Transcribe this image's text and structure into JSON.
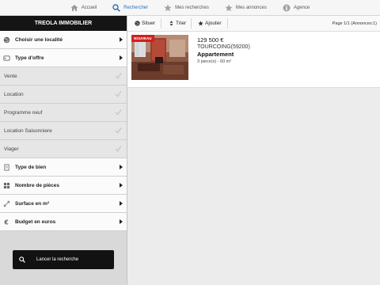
{
  "nav": {
    "items": [
      {
        "label": "Accueil",
        "icon": "home-icon"
      },
      {
        "label": "Rechercher",
        "icon": "search-icon",
        "active": true
      },
      {
        "label": "Mes recherches",
        "icon": "star-icon"
      },
      {
        "label": "Mes annonces",
        "icon": "star-icon"
      },
      {
        "label": "Agence",
        "icon": "info-icon"
      }
    ]
  },
  "sidebar": {
    "brand": "TREOLA IMMOBILIER",
    "locality_label": "Choisir une localité",
    "offer_label": "Type d'offre",
    "offer_options": [
      "Vente",
      "Location",
      "Programme neuf",
      "Location Saisonniere",
      "Viager"
    ],
    "property_type_label": "Type de bien",
    "rooms_label": "Nombre de pièces",
    "surface_label": "Surface en m²",
    "budget_label": "Budget en euros",
    "search_button": "Lancer la recherche"
  },
  "toolbar": {
    "situer": "Situer",
    "trier": "Trier",
    "ajouter": "Ajouter",
    "page_info": "Page 1/1 (Annonces:1)"
  },
  "listing": {
    "badge": "NOUVEAU",
    "price": "129 500 €",
    "city": "TOURCOING(59200)",
    "type": "Appartement",
    "details": "3 piece(s) - 60 m²"
  },
  "colors": {
    "accent": "#2e6fb7",
    "brand_bar": "#151515",
    "badge": "#d21f1f"
  }
}
